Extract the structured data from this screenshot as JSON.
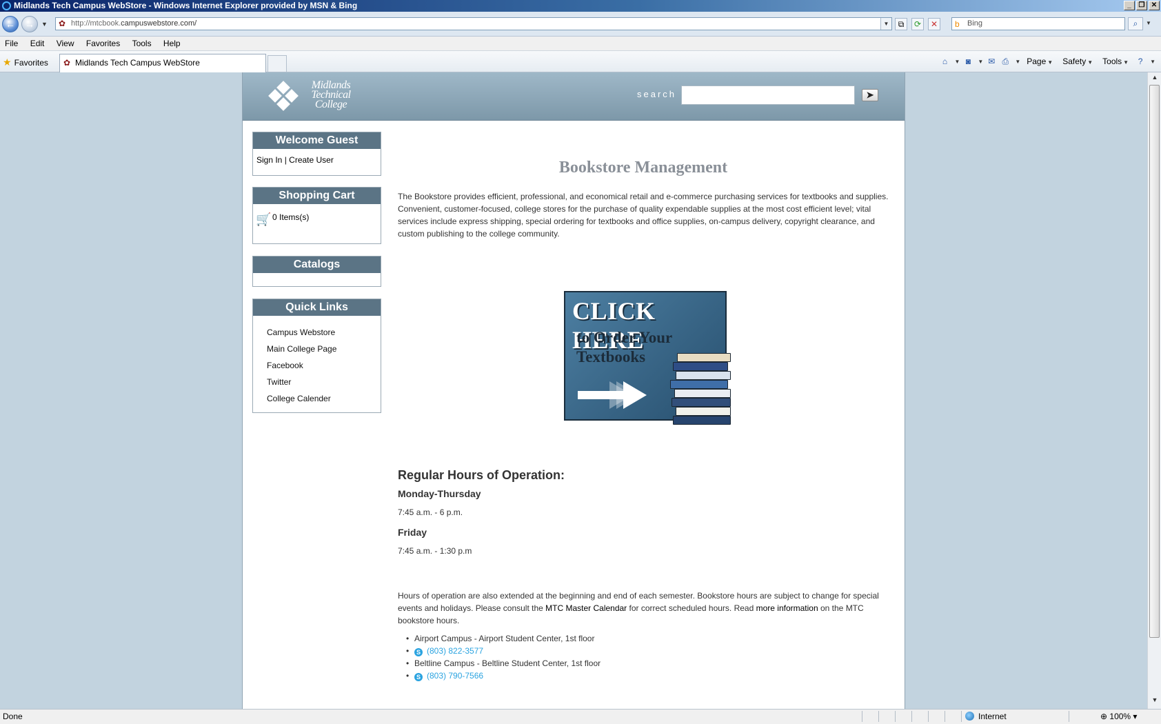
{
  "browser": {
    "title": "Midlands Tech Campus WebStore - Windows Internet Explorer provided by MSN & Bing",
    "url_prefix": "http://mtcbook.",
    "url_domain": "campuswebstore.com/",
    "search_placeholder": "Bing",
    "menu": [
      "File",
      "Edit",
      "View",
      "Favorites",
      "Tools",
      "Help"
    ],
    "favorites_label": "Favorites",
    "tab_title": "Midlands Tech Campus WebStore",
    "commands": {
      "page": "Page",
      "safety": "Safety",
      "tools": "Tools"
    },
    "status": {
      "left": "Done",
      "zone": "Internet",
      "zoom": "100%"
    }
  },
  "site": {
    "logo_text": [
      "Midlands",
      "Technical",
      "College"
    ],
    "search_label": "search",
    "search_button": "➤"
  },
  "sidebar": {
    "welcome": {
      "title": "Welcome Guest",
      "sign_in": "Sign In",
      "separator": " | ",
      "create_user": "Create User"
    },
    "cart": {
      "title": "Shopping Cart",
      "items": "0 Items(s)"
    },
    "catalogs": {
      "title": "Catalogs"
    },
    "quick_links": {
      "title": "Quick Links",
      "items": [
        "Campus Webstore",
        "Main College Page",
        "Facebook",
        "Twitter",
        "College Calender"
      ]
    }
  },
  "main": {
    "title": "Bookstore Management",
    "intro": "The Bookstore provides efficient, professional, and economical retail and e-commerce purchasing services for textbooks and supplies.  Convenient, customer-focused, college stores for the purchase of quality expendable supplies at the most cost efficient level; vital services  include express shipping, special ordering for textbooks and office supplies, on-campus delivery, copyright clearance, and custom publishing to the college community.",
    "banner": {
      "line1": "CLICK HERE",
      "line2": "to Order Your Textbooks"
    },
    "hours_title": "Regular Hours of Operation:",
    "days": [
      {
        "day": "Monday-Thursday",
        "time": "7:45 a.m. - 6 p.m."
      },
      {
        "day": "Friday",
        "time": "7:45 a.m. - 1:30 p.m"
      }
    ],
    "note": {
      "part1": "Hours of operation are also extended at the beginning and end of each semester. Bookstore hours are subject to change for special events and holidays. Please consult the ",
      "link1": "MTC Master Calendar",
      "part2": " for correct scheduled hours. Read ",
      "link2": "more information",
      "part3": " on the MTC bookstore hours."
    },
    "campuses": [
      {
        "name": "Airport Campus - Airport Student Center, 1st floor",
        "phone": "(803) 822-3577"
      },
      {
        "name": "Beltline Campus - Beltline Student Center, 1st floor",
        "phone": "(803) 790-7566"
      }
    ]
  },
  "colors": {
    "page_background": "#c2d3df",
    "header_gradient": "#7d98a9",
    "box_header": "#5b7485",
    "phone_link": "#2aa3e0",
    "title_gray": "#8a9098"
  }
}
